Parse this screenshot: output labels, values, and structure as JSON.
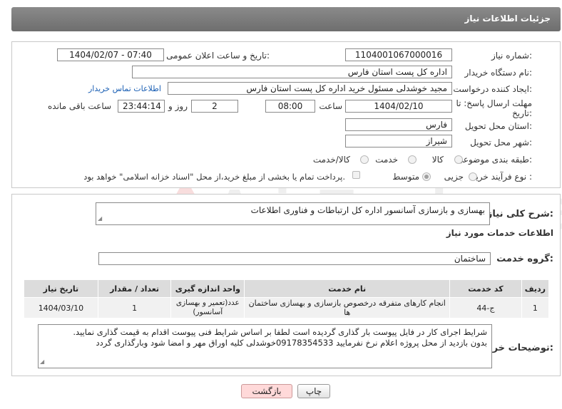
{
  "header": {
    "title": "جزئیات اطلاعات نیاز"
  },
  "form": {
    "need_number": {
      "label": "شماره نیاز:",
      "value": "1104001067000016"
    },
    "announce_datetime": {
      "label": "تاریخ و ساعت اعلان عمومی:",
      "value": "1404/02/07 - 07:40"
    },
    "buyer_org": {
      "label": "نام دستگاه خریدار:",
      "value": "اداره کل پست استان فارس"
    },
    "requester": {
      "label": "ایجاد کننده درخواست:",
      "value": "مجید خوشدلی مسئول خرید اداره کل پست استان فارس",
      "contact_link": "اطلاعات تماس خریدار"
    },
    "deadline": {
      "label_line1": "مهلت ارسال پاسخ: تا",
      "label_line2": "تاریخ:",
      "date": "1404/02/10",
      "time_label": "ساعت",
      "time": "08:00",
      "days": "2",
      "days_label": "روز و",
      "remaining": "23:44:14",
      "remaining_label": "ساعت باقی مانده"
    },
    "province": {
      "label": "استان محل تحویل:",
      "value": "فارس"
    },
    "city": {
      "label": "شهر محل تحویل:",
      "value": "شیراز"
    },
    "category": {
      "label": "طبقه بندی موضوعی:",
      "options": [
        "کالا",
        "خدمت",
        "کالا/خدمت"
      ]
    },
    "purchase_type": {
      "label": "نوع فرآیند خرید :",
      "options": [
        "جزیی",
        "متوسط"
      ],
      "payment_note": "پرداخت تمام یا بخشی از مبلغ خرید،از محل \"اسناد خزانه اسلامی\" خواهد بود."
    }
  },
  "description": {
    "label": "شرح کلی نیاز:",
    "value": "بهسازی و بازسازی آسانسور اداره کل ارتباطات و فناوری اطلاعات"
  },
  "services": {
    "section_title": "اطلاعات خدمات مورد نیاز",
    "group_label": "گروه خدمت:",
    "group_value": "ساختمان",
    "columns": [
      "ردیف",
      "کد خدمت",
      "نام خدمت",
      "واحد اندازه گیری",
      "تعداد / مقدار",
      "تاریخ نیاز"
    ],
    "rows": [
      {
        "row": "1",
        "code": "ج-44",
        "name": "انجام کارهای متفرقه درخصوص بازسازی و بهسازی ساختمان ها",
        "unit": "عدد(تعمیر و بهسازی آسانسور)",
        "qty": "1",
        "date": "1404/03/10"
      }
    ]
  },
  "buyer_notes": {
    "label": "توضیحات خریدار:",
    "line1": "شرایط اجرای کار در فایل پیوست بار گذاری گردیده است لطفا بر اساس شرایط فنی پیوست اقدام به قیمت گذاری نمایید.",
    "line2": "بدون بازدید از محل پروژه اعلام نرخ نفرمایید 09178354533خوشدلی کلیه اوراق مهر و امضا شود وبارگذاری گردد"
  },
  "buttons": {
    "print": "چاپ",
    "back": "بازگشت"
  },
  "watermark": "AriaTender.neT"
}
